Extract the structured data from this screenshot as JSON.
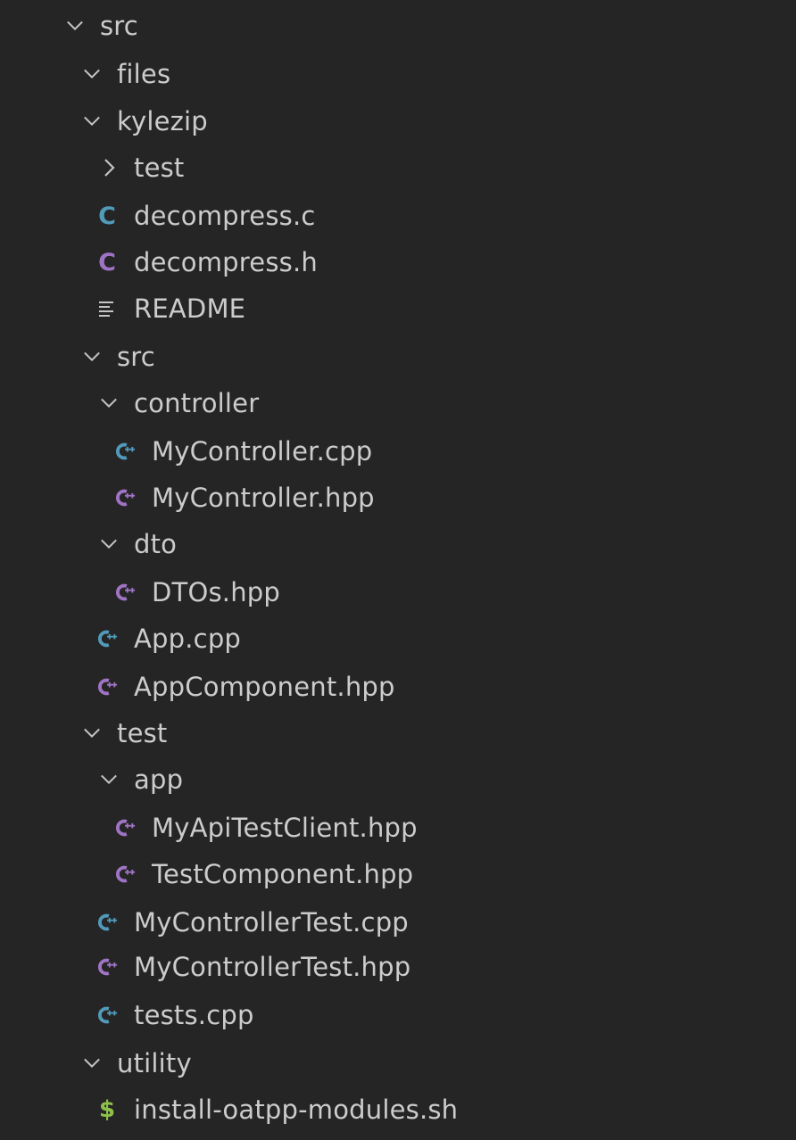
{
  "colors": {
    "background": "#252526",
    "text": "#cccccc",
    "twistie": "#c5c5c5",
    "c_source": "#519aba",
    "c_header": "#a074c4",
    "shell": "#8dc149"
  },
  "tree": [
    {
      "label": "src",
      "type": "folder",
      "expanded": true,
      "icon": "chevron-down-icon"
    },
    {
      "label": "files",
      "type": "folder",
      "expanded": true,
      "icon": "chevron-down-icon"
    },
    {
      "label": "kylezip",
      "type": "folder",
      "expanded": true,
      "icon": "chevron-down-icon"
    },
    {
      "label": "test",
      "type": "folder",
      "expanded": false,
      "icon": "chevron-right-icon"
    },
    {
      "label": "decompress.c",
      "type": "file",
      "icon": "c-file-icon"
    },
    {
      "label": "decompress.h",
      "type": "file",
      "icon": "c-header-icon"
    },
    {
      "label": "README",
      "type": "file",
      "icon": "text-lines-icon"
    },
    {
      "label": "src",
      "type": "folder",
      "expanded": true,
      "icon": "chevron-down-icon"
    },
    {
      "label": "controller",
      "type": "folder",
      "expanded": true,
      "icon": "chevron-down-icon"
    },
    {
      "label": "MyController.cpp",
      "type": "file",
      "icon": "cpp-file-icon"
    },
    {
      "label": "MyController.hpp",
      "type": "file",
      "icon": "cpp-header-icon"
    },
    {
      "label": "dto",
      "type": "folder",
      "expanded": true,
      "icon": "chevron-down-icon"
    },
    {
      "label": "DTOs.hpp",
      "type": "file",
      "icon": "cpp-header-icon"
    },
    {
      "label": "App.cpp",
      "type": "file",
      "icon": "cpp-file-icon"
    },
    {
      "label": "AppComponent.hpp",
      "type": "file",
      "icon": "cpp-header-icon"
    },
    {
      "label": "test",
      "type": "folder",
      "expanded": true,
      "icon": "chevron-down-icon"
    },
    {
      "label": "app",
      "type": "folder",
      "expanded": true,
      "icon": "chevron-down-icon"
    },
    {
      "label": "MyApiTestClient.hpp",
      "type": "file",
      "icon": "cpp-header-icon"
    },
    {
      "label": "TestComponent.hpp",
      "type": "file",
      "icon": "cpp-header-icon"
    },
    {
      "label": "MyControllerTest.cpp",
      "type": "file",
      "icon": "cpp-file-icon"
    },
    {
      "label": "MyControllerTest.hpp",
      "type": "file",
      "icon": "cpp-header-icon"
    },
    {
      "label": "tests.cpp",
      "type": "file",
      "icon": "cpp-file-icon"
    },
    {
      "label": "utility",
      "type": "folder",
      "expanded": true,
      "icon": "chevron-down-icon"
    },
    {
      "label": "install-oatpp-modules.sh",
      "type": "file",
      "icon": "shell-file-icon"
    }
  ]
}
